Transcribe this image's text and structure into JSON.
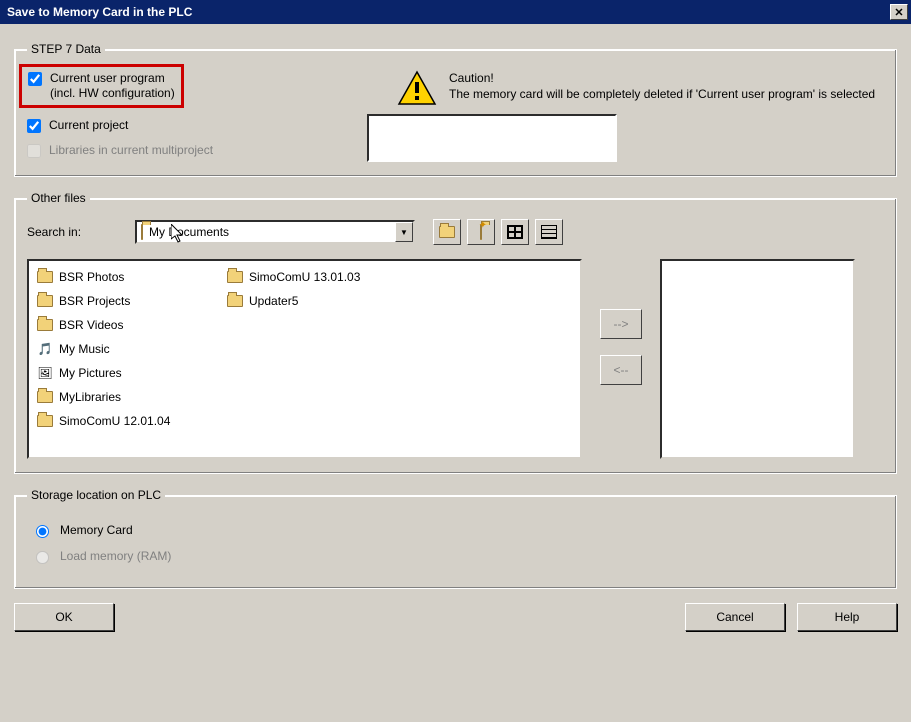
{
  "window": {
    "title": "Save to Memory Card in the PLC"
  },
  "step7": {
    "legend": "STEP 7 Data",
    "chk_user_prog_line1": "Current user program",
    "chk_user_prog_line2": "(incl. HW configuration)",
    "chk_user_prog_checked": true,
    "chk_current_project": "Current project",
    "chk_current_project_checked": true,
    "chk_libraries": "Libraries in current multiproject",
    "chk_libraries_checked": false,
    "caution_head": "Caution!",
    "caution_body": "The memory card will be completely deleted if 'Current user program' is selected"
  },
  "other": {
    "legend": "Other files",
    "search_label": "Search in:",
    "search_value": "My Documents",
    "up_tooltip": "Up one level",
    "newfolder_tooltip": "Create new folder",
    "view_list_tooltip": "List",
    "view_detail_tooltip": "Details",
    "arrow_right": "-->",
    "arrow_left": "<--",
    "items_left": [
      {
        "name": "BSR Photos",
        "icon": "folder"
      },
      {
        "name": "BSR Projects",
        "icon": "folder"
      },
      {
        "name": "BSR Videos",
        "icon": "folder"
      },
      {
        "name": "My Music",
        "icon": "music"
      },
      {
        "name": "My Pictures",
        "icon": "pictures"
      },
      {
        "name": "MyLibraries",
        "icon": "folder"
      }
    ],
    "items_right": [
      {
        "name": "SimoComU 12.01.04",
        "icon": "folder"
      },
      {
        "name": "SimoComU 13.01.03",
        "icon": "folder"
      },
      {
        "name": "Updater5",
        "icon": "folder"
      }
    ]
  },
  "storage": {
    "legend": "Storage location on PLC",
    "opt_memcard": "Memory Card",
    "opt_ram": "Load memory (RAM)"
  },
  "buttons": {
    "ok": "OK",
    "cancel": "Cancel",
    "help": "Help"
  }
}
